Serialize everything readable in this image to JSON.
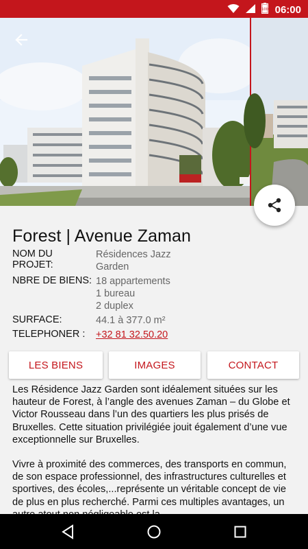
{
  "status_bar": {
    "time": "06:00",
    "icons": [
      "wifi-icon",
      "signal-icon",
      "battery-icon"
    ],
    "color": "#c4161c"
  },
  "project": {
    "title": "Forest | Avenue Zaman",
    "fields": {
      "project_label": "NOM DU PROJET:",
      "project_value_1": "Résidences Jazz",
      "project_value_2": "Garden",
      "units_label": "NBRE DE BIENS:",
      "units_value_1": "18 appartements",
      "units_value_2": "1 bureau",
      "units_value_3": "2 duplex",
      "surface_label": "SURFACE:",
      "surface_value": "44.1 à 377.0 m²",
      "phone_label": "TELEPHONER :",
      "phone_value": "+32 81 32.50.20"
    }
  },
  "buttons": {
    "biens": "LES BIENS",
    "images": "IMAGES",
    "contact": "CONTACT"
  },
  "description": {
    "p1": "Les Résidence Jazz Garden sont idéalement situées sur les hauteur de Forest, à l’angle des avenues Zaman – du Globe et Victor Rousseau dans l’un des quartiers les plus prisés de Bruxelles. Cette situation privilégiée jouit également d’une vue exceptionnelle sur Bruxelles.",
    "p2": "Vivre à proximité des commerces, des transports en commun, de son espace professionnel, des infrastructures culturelles et sportives, des écoles,...représente un véritable concept de vie de plus en plus recherché. Parmi ces multiples avantages, un autre atout non négligeable est la"
  },
  "colors": {
    "accent": "#c4161c",
    "secondary_text": "#666666",
    "background": "#f2f2f2"
  }
}
